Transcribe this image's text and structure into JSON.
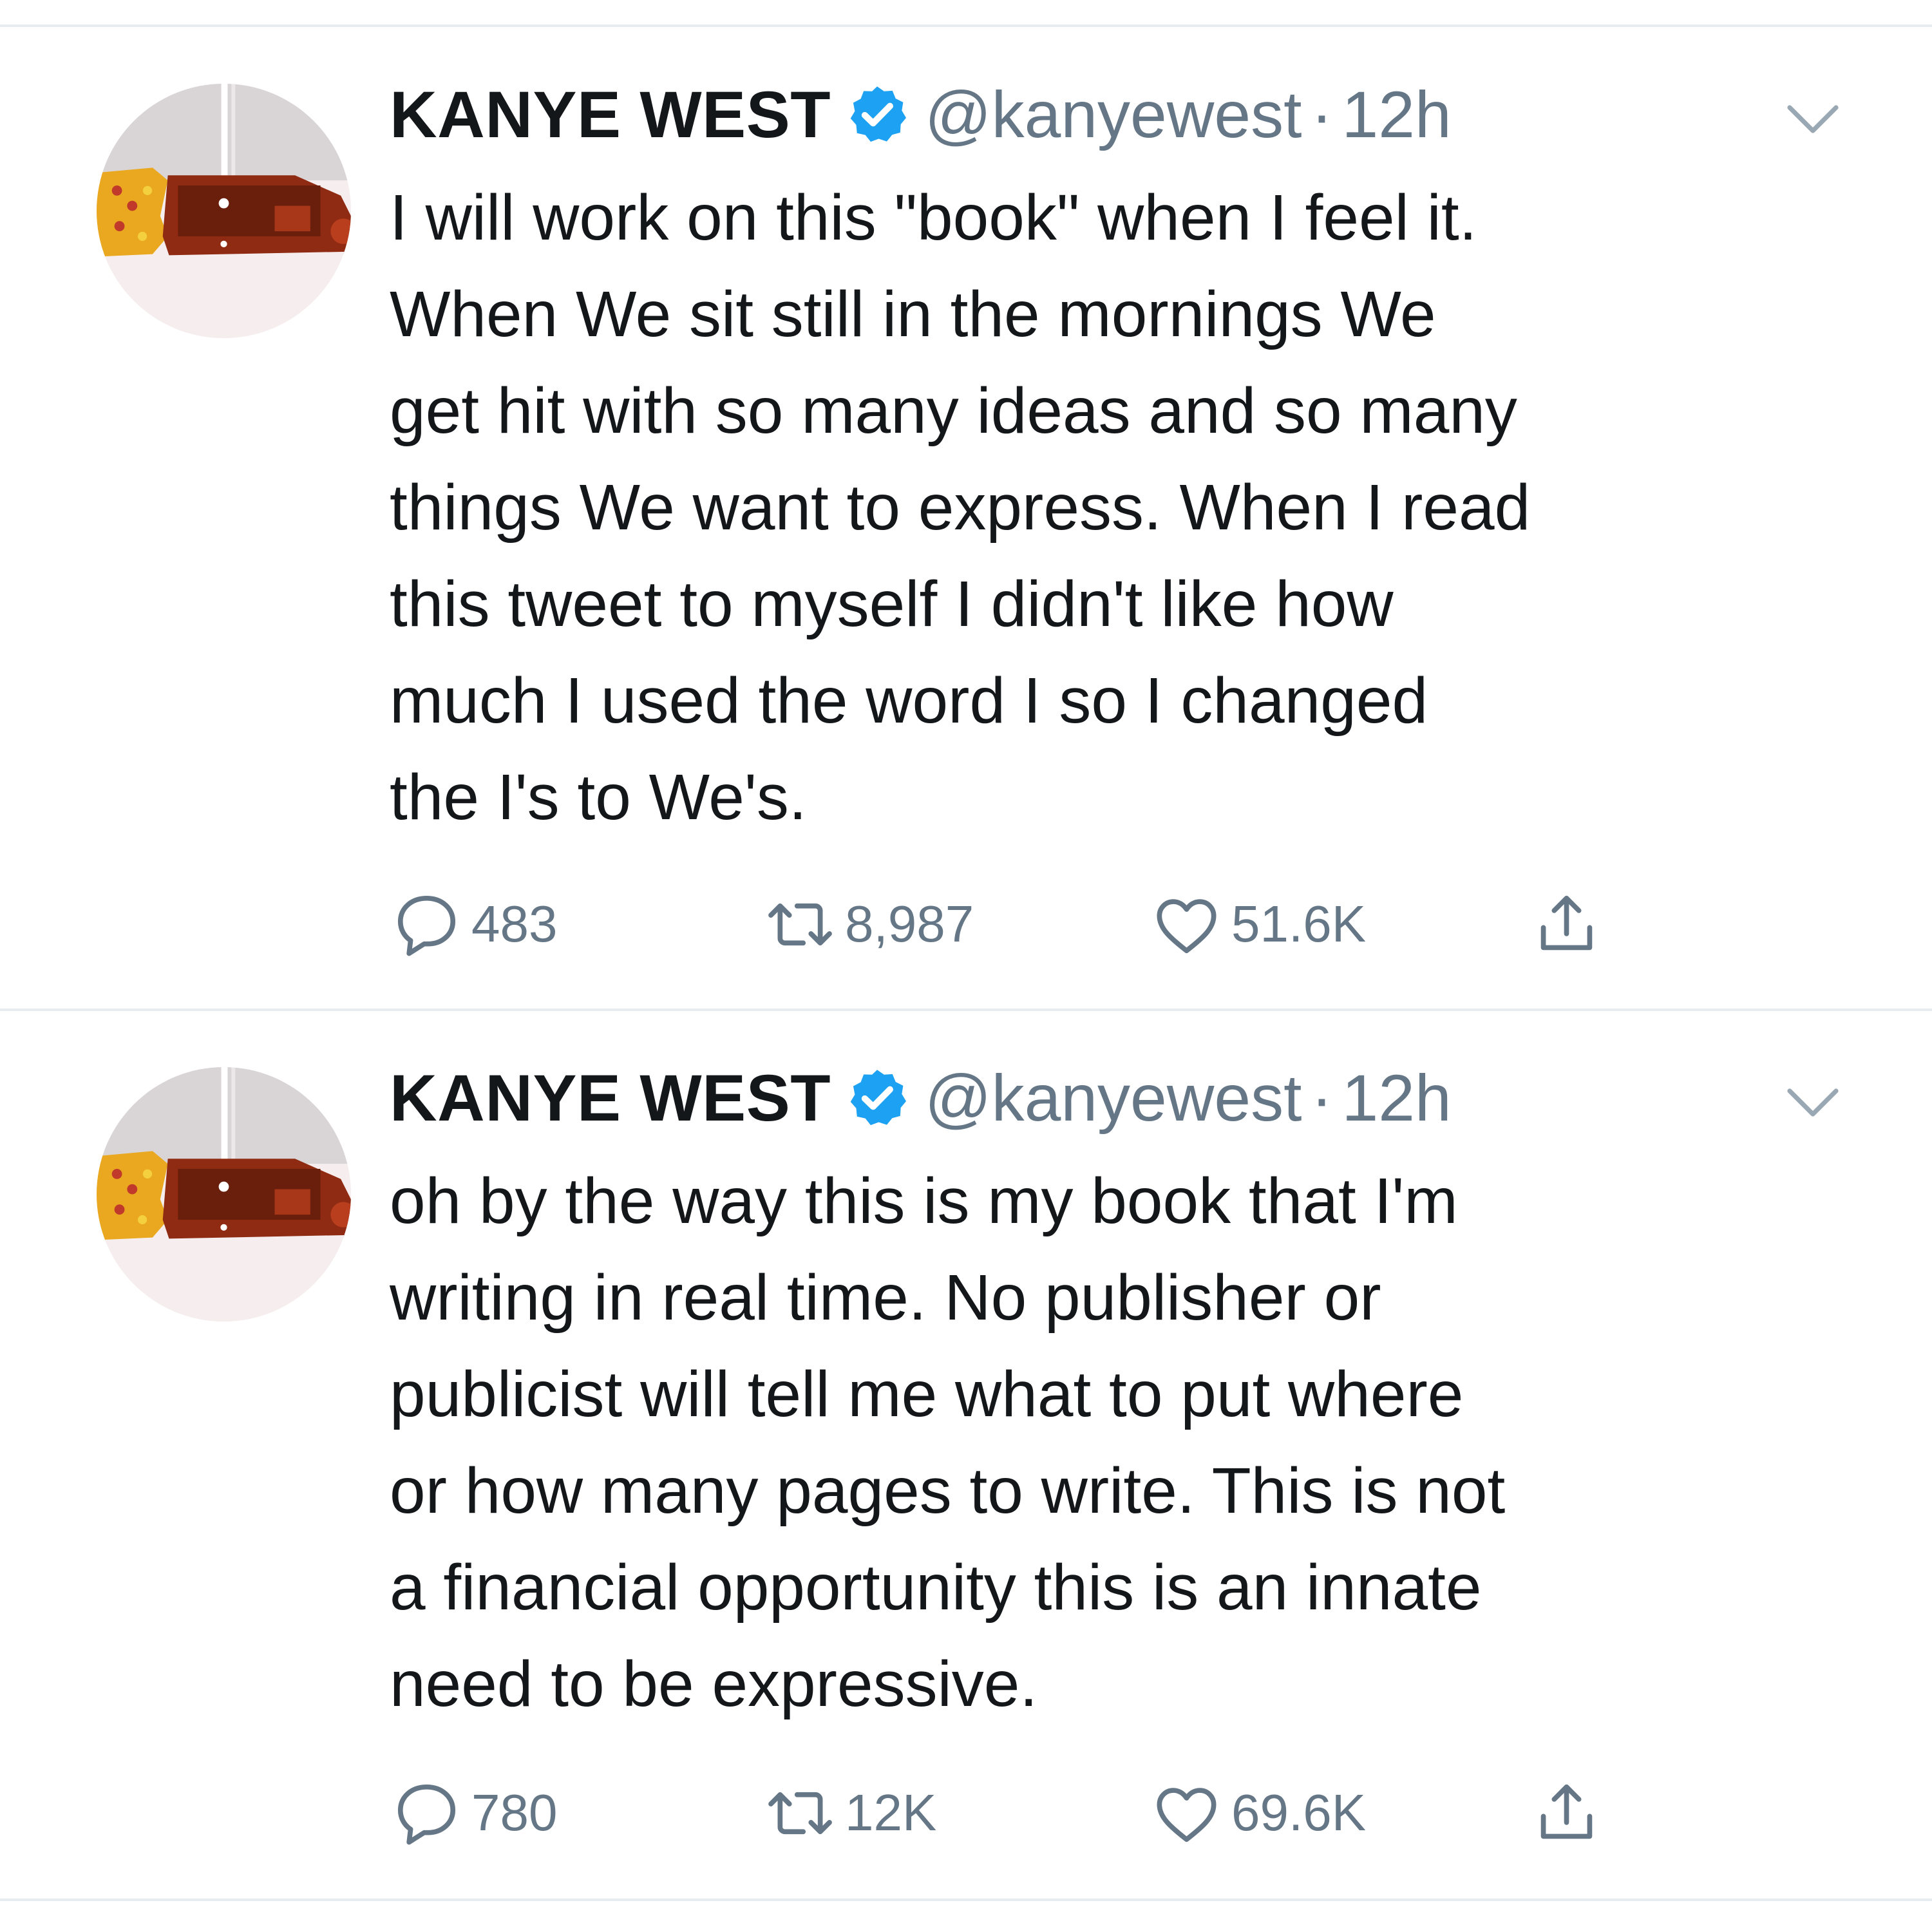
{
  "colors": {
    "text": "#14171a",
    "secondary": "#657786",
    "verified_blue": "#1da1f2",
    "divider": "#e6ecf0"
  },
  "tweets": [
    {
      "name": "KANYE WEST",
      "verified_icon": "verified-badge-icon",
      "handle": "@kanyewest",
      "separator": "·",
      "time": "12h",
      "lines": [
        "I will work on this \"book\" when I feel it.",
        "When We sit still in the mornings We",
        "get hit with so many ideas and so many",
        "things We want to express. When I read",
        "this tweet to myself I didn't like how",
        "much I used the word I so I changed",
        "the I's to We's."
      ],
      "replies": "483",
      "retweets": "8,987",
      "likes": "51.6K"
    },
    {
      "name": "KANYE WEST",
      "verified_icon": "verified-badge-icon",
      "handle": "@kanyewest",
      "separator": "·",
      "time": "12h",
      "lines": [
        "oh by the way this is my book that I'm",
        "writing in real time. No publisher or",
        "publicist will tell me what to put where",
        "or how many pages to write. This is not",
        "a financial opportunity this is an innate",
        "need to be expressive."
      ],
      "replies": "780",
      "retweets": "12K",
      "likes": "69.6K"
    }
  ]
}
